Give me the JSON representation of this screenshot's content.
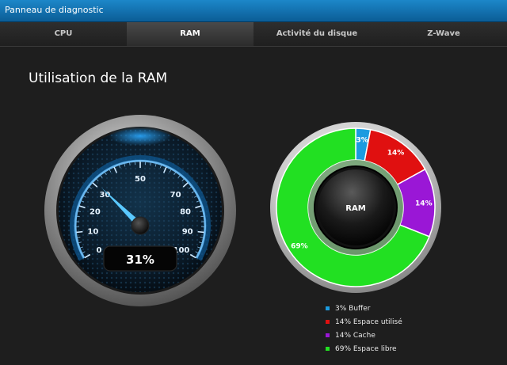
{
  "window": {
    "title": "Panneau de diagnostic"
  },
  "tabs": [
    {
      "label": "CPU",
      "active": false
    },
    {
      "label": "RAM",
      "active": true
    },
    {
      "label": "Activité du disque",
      "active": false
    },
    {
      "label": "Z-Wave",
      "active": false
    }
  ],
  "page": {
    "heading": "Utilisation de la RAM"
  },
  "gauge": {
    "value": 31,
    "value_label": "31%",
    "min": 0,
    "max": 100,
    "tick_labels": [
      "0",
      "10",
      "20",
      "30",
      "50",
      "70",
      "80",
      "90",
      "100"
    ]
  },
  "donut": {
    "center_label": "RAM",
    "segments": [
      {
        "label": "3%",
        "value": 3,
        "color": "#1b9be0"
      },
      {
        "label": "14%",
        "value": 14,
        "color": "#e01010"
      },
      {
        "label": "14%",
        "value": 14,
        "color": "#9a17d6"
      },
      {
        "label": "69%",
        "value": 69,
        "color": "#22e022"
      }
    ]
  },
  "legend": [
    {
      "label": "3% Buffer",
      "color": "#1b9be0"
    },
    {
      "label": "14% Espace utilisé",
      "color": "#e01010"
    },
    {
      "label": "14% Cache",
      "color": "#9a17d6"
    },
    {
      "label": "69% Espace libre",
      "color": "#22e022"
    }
  ]
}
